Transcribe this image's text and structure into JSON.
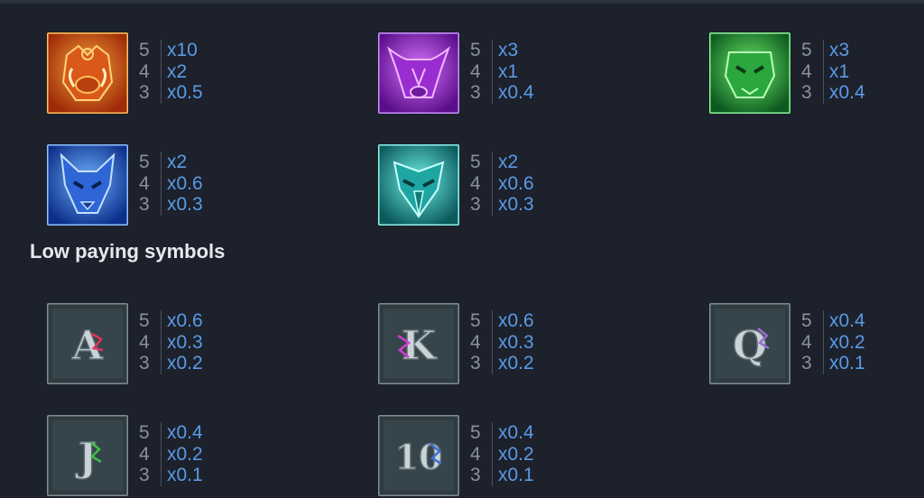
{
  "high_symbols": [
    {
      "icon": "boar-mask-icon",
      "color": "#e0641a",
      "pays": [
        {
          "count": "5",
          "mult": "x10"
        },
        {
          "count": "4",
          "mult": "x2"
        },
        {
          "count": "3",
          "mult": "x0.5"
        }
      ]
    },
    {
      "icon": "bull-mask-icon",
      "color": "#a030d6",
      "pays": [
        {
          "count": "5",
          "mult": "x3"
        },
        {
          "count": "4",
          "mult": "x1"
        },
        {
          "count": "3",
          "mult": "x0.4"
        }
      ]
    },
    {
      "icon": "snake-mask-icon",
      "color": "#26b34a",
      "pays": [
        {
          "count": "5",
          "mult": "x3"
        },
        {
          "count": "4",
          "mult": "x1"
        },
        {
          "count": "3",
          "mult": "x0.4"
        }
      ]
    },
    {
      "icon": "wolf-mask-icon",
      "color": "#2f6ee0",
      "pays": [
        {
          "count": "5",
          "mult": "x2"
        },
        {
          "count": "4",
          "mult": "x0.6"
        },
        {
          "count": "3",
          "mult": "x0.3"
        }
      ]
    },
    {
      "icon": "eagle-mask-icon",
      "color": "#1fa6a3",
      "pays": [
        {
          "count": "5",
          "mult": "x2"
        },
        {
          "count": "4",
          "mult": "x0.6"
        },
        {
          "count": "3",
          "mult": "x0.3"
        }
      ]
    }
  ],
  "low_title": "Low paying symbols",
  "low_symbols": [
    {
      "icon": "letter-a-icon",
      "letter": "A",
      "pays": [
        {
          "count": "5",
          "mult": "x0.6"
        },
        {
          "count": "4",
          "mult": "x0.3"
        },
        {
          "count": "3",
          "mult": "x0.2"
        }
      ]
    },
    {
      "icon": "letter-k-icon",
      "letter": "K",
      "pays": [
        {
          "count": "5",
          "mult": "x0.6"
        },
        {
          "count": "4",
          "mult": "x0.3"
        },
        {
          "count": "3",
          "mult": "x0.2"
        }
      ]
    },
    {
      "icon": "letter-q-icon",
      "letter": "Q",
      "pays": [
        {
          "count": "5",
          "mult": "x0.4"
        },
        {
          "count": "4",
          "mult": "x0.2"
        },
        {
          "count": "3",
          "mult": "x0.1"
        }
      ]
    },
    {
      "icon": "letter-j-icon",
      "letter": "J",
      "pays": [
        {
          "count": "5",
          "mult": "x0.4"
        },
        {
          "count": "4",
          "mult": "x0.2"
        },
        {
          "count": "3",
          "mult": "x0.1"
        }
      ]
    },
    {
      "icon": "number-10-icon",
      "letter": "10",
      "pays": [
        {
          "count": "5",
          "mult": "x0.4"
        },
        {
          "count": "4",
          "mult": "x0.2"
        },
        {
          "count": "3",
          "mult": "x0.1"
        }
      ]
    }
  ]
}
